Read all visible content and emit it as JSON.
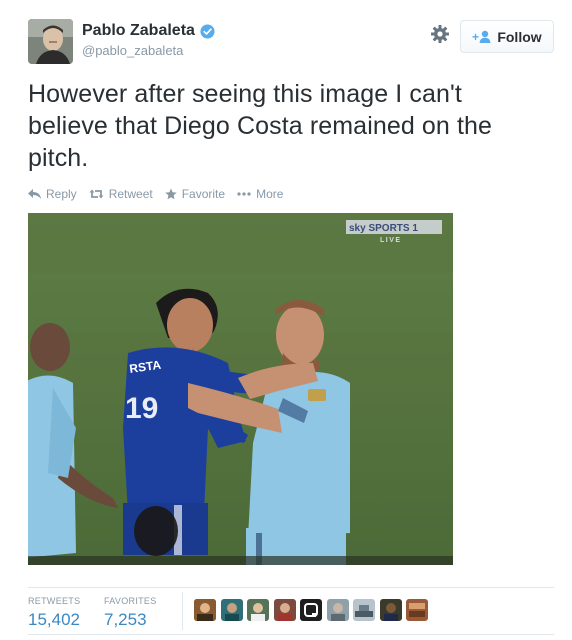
{
  "user": {
    "name": "Pablo Zabaleta",
    "handle": "@pablo_zabaleta",
    "verified": true
  },
  "header": {
    "settings_icon": "gear-icon",
    "follow_label": "Follow"
  },
  "tweet": {
    "text": "However after seeing this image I can't believe that Diego Costa remained on the pitch."
  },
  "actions": [
    {
      "icon": "reply-icon",
      "label": "Reply"
    },
    {
      "icon": "retweet-icon",
      "label": "Retweet"
    },
    {
      "icon": "star-icon",
      "label": "Favorite"
    },
    {
      "icon": "more-dots-icon",
      "label": "More"
    }
  ],
  "media": {
    "broadcaster_logo": "sky SPORTS 1",
    "live_label": "LIVE",
    "shirt_text": "RSTA",
    "shirt_number": "19"
  },
  "stats": {
    "retweets_label": "RETWEETS",
    "retweets_value": "15,402",
    "favorites_label": "FAVORITES",
    "favorites_value": "7,253"
  },
  "colors": {
    "link_blue": "#3b88c3",
    "verified_blue": "#55acee",
    "muted": "#8899a6",
    "chelsea_blue": "#1c3f9e",
    "city_blue": "#8fc6e3"
  }
}
